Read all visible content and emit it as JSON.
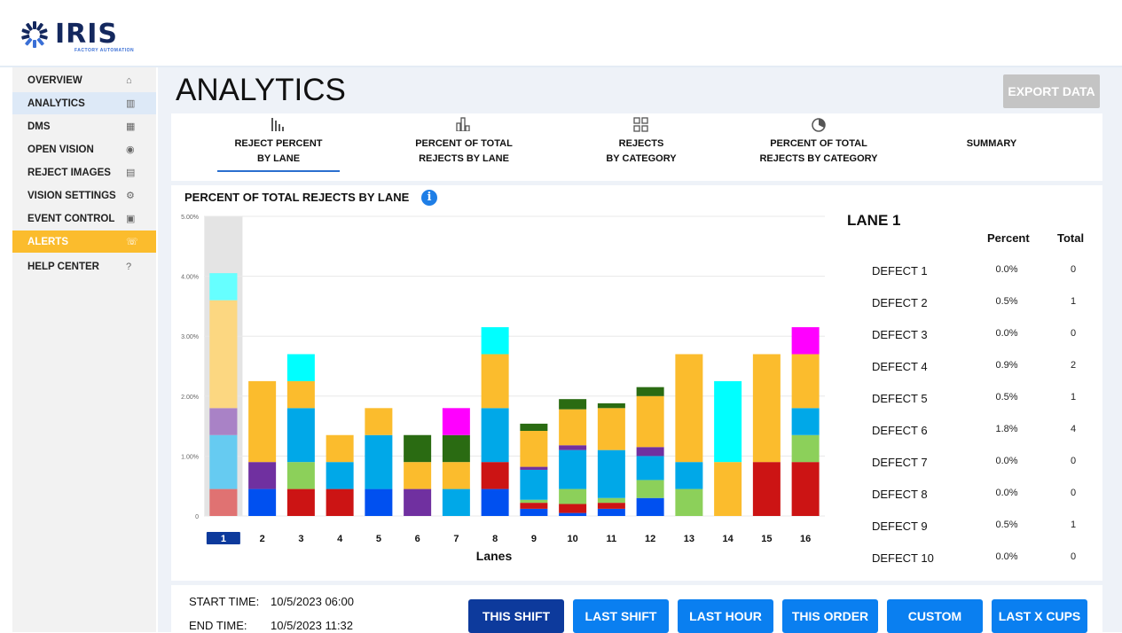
{
  "brand": {
    "name": "IRIS",
    "tagline": "FACTORY AUTOMATION"
  },
  "sidebar": {
    "items": [
      {
        "label": "OVERVIEW",
        "icon": "home-icon"
      },
      {
        "label": "ANALYTICS",
        "icon": "bar-chart-icon",
        "active": true
      },
      {
        "label": "DMS",
        "icon": "table-icon"
      },
      {
        "label": "OPEN VISION",
        "icon": "vision-icon"
      },
      {
        "label": "REJECT IMAGES",
        "icon": "image-file-icon"
      },
      {
        "label": "VISION SETTINGS",
        "icon": "gear-icon"
      },
      {
        "label": "EVENT CONTROL",
        "icon": "calendar-icon"
      },
      {
        "label": "ALERTS",
        "icon": "alarm-icon",
        "highlight": "#fbbc2d"
      },
      {
        "label": "HELP CENTER",
        "icon": "help-icon"
      }
    ]
  },
  "page": {
    "title": "ANALYTICS",
    "export_label": "EXPORT DATA"
  },
  "tabs": [
    {
      "label": "REJECT PERCENT\nBY LANE",
      "icon": "bars-icon",
      "active": true
    },
    {
      "label": "PERCENT OF TOTAL\nREJECTS BY LANE",
      "icon": "bar-chart-icon"
    },
    {
      "label": "REJECTS\nBY CATEGORY",
      "icon": "grid-icon"
    },
    {
      "label": "PERCENT OF TOTAL\nREJECTS BY CATEGORY",
      "icon": "pie-icon"
    },
    {
      "label": "SUMMARY",
      "icon": ""
    }
  ],
  "chart_data": {
    "type": "bar",
    "stacked": true,
    "title": "PERCENT OF TOTAL REJECTS BY LANE",
    "xlabel": "Lanes",
    "ylabel": "",
    "ylim": [
      0,
      5
    ],
    "yticks": [
      "0",
      "1.00%",
      "2.00%",
      "3.00%",
      "4.00%",
      "5.00%"
    ],
    "categories": [
      "1",
      "2",
      "3",
      "4",
      "5",
      "6",
      "7",
      "8",
      "9",
      "10",
      "11",
      "12",
      "13",
      "14",
      "15",
      "16"
    ],
    "selected_category": "1",
    "series": [
      {
        "color": "#0050f0",
        "values": [
          0,
          0.45,
          0,
          0,
          0.45,
          0,
          0,
          0.45,
          0.12,
          0.05,
          0.12,
          0.3,
          0,
          0,
          0,
          0
        ]
      },
      {
        "color": "#cc1414",
        "values": [
          0.45,
          0,
          0.45,
          0.45,
          0,
          0,
          0,
          0.45,
          0.1,
          0.15,
          0.1,
          0,
          0,
          0,
          0.9,
          0.9
        ]
      },
      {
        "color": "#8cd05a",
        "values": [
          0,
          0,
          0.45,
          0,
          0,
          0,
          0,
          0,
          0.05,
          0.25,
          0.08,
          0.3,
          0.45,
          0,
          0,
          0.45
        ]
      },
      {
        "color": "#00a8e8",
        "values": [
          0.9,
          0,
          0.9,
          0.45,
          0.9,
          0,
          0.45,
          0.9,
          0.5,
          0.65,
          0.8,
          0.4,
          0.45,
          0,
          0,
          0.45
        ]
      },
      {
        "color": "#7030a0",
        "values": [
          0.45,
          0.45,
          0,
          0,
          0,
          0.45,
          0,
          0,
          0.05,
          0.08,
          0,
          0.15,
          0,
          0,
          0,
          0
        ]
      },
      {
        "color": "#fbbc2d",
        "values": [
          1.8,
          1.35,
          0.45,
          0.45,
          0.45,
          0.45,
          0.45,
          0.9,
          0.6,
          0.6,
          0.7,
          0.85,
          1.8,
          0.9,
          1.8,
          0.9
        ]
      },
      {
        "color": "#00ffff",
        "values": [
          0.45,
          0,
          0.45,
          0,
          0,
          0,
          0,
          0.45,
          0,
          0,
          0,
          0,
          0,
          1.35,
          0,
          0
        ]
      },
      {
        "color": "#2a6b12",
        "values": [
          0,
          0,
          0,
          0,
          0,
          0.45,
          0.45,
          0,
          0.12,
          0.17,
          0.08,
          0.15,
          0,
          0,
          0,
          0
        ]
      },
      {
        "color": "#ff00ff",
        "values": [
          0,
          0,
          0,
          0,
          0,
          0,
          0.45,
          0,
          0,
          0,
          0,
          0,
          0,
          0,
          0,
          0.45
        ]
      }
    ]
  },
  "lane_detail": {
    "title": "LANE 1",
    "col_percent": "Percent",
    "col_total": "Total",
    "rows": [
      {
        "name": "DEFECT 1",
        "percent": "0.0%",
        "total": "0"
      },
      {
        "name": "DEFECT 2",
        "percent": "0.5%",
        "total": "1"
      },
      {
        "name": "DEFECT 3",
        "percent": "0.0%",
        "total": "0"
      },
      {
        "name": "DEFECT 4",
        "percent": "0.9%",
        "total": "2"
      },
      {
        "name": "DEFECT 5",
        "percent": "0.5%",
        "total": "1"
      },
      {
        "name": "DEFECT 6",
        "percent": "1.8%",
        "total": "4"
      },
      {
        "name": "DEFECT 7",
        "percent": "0.0%",
        "total": "0"
      },
      {
        "name": "DEFECT 8",
        "percent": "0.0%",
        "total": "0"
      },
      {
        "name": "DEFECT 9",
        "percent": "0.5%",
        "total": "1"
      },
      {
        "name": "DEFECT 10",
        "percent": "0.0%",
        "total": "0"
      }
    ]
  },
  "time": {
    "start_label": "START TIME:",
    "start_value": "10/5/2023 06:00",
    "end_label": "END TIME:",
    "end_value": "10/5/2023 11:32"
  },
  "range_buttons": [
    {
      "label": "THIS SHIFT",
      "active": true
    },
    {
      "label": "LAST SHIFT"
    },
    {
      "label": "LAST HOUR"
    },
    {
      "label": "THIS ORDER"
    },
    {
      "label": "CUSTOM"
    },
    {
      "label": "LAST X CUPS"
    }
  ],
  "colors": {
    "accent": "#0a7ff0",
    "active_button": "#0d3a9c",
    "alert": "#fbbc2d",
    "brand": "#14285e"
  }
}
